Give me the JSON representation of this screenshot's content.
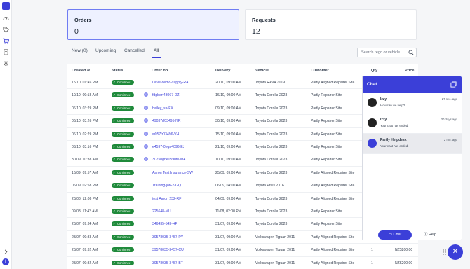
{
  "sidebar": {
    "icons": [
      "logo-icon",
      "dashboard-icon",
      "tag-icon",
      "cart-icon",
      "document-icon",
      "settings-icon"
    ],
    "expand_icon": "chevron-right-icon",
    "user_initial": "I"
  },
  "cards": {
    "orders": {
      "title": "Orders",
      "value": "0"
    },
    "requests": {
      "title": "Requests",
      "value": "12"
    }
  },
  "tabs": [
    {
      "label": "New (0)"
    },
    {
      "label": "Upcoming"
    },
    {
      "label": "Cancelled"
    },
    {
      "label": "All"
    }
  ],
  "search": {
    "placeholder": "Search rego or vehicle"
  },
  "table": {
    "headers": [
      "Created at",
      "Status",
      "Order no.",
      "Delivery",
      "Vehicle",
      "Customer",
      "Qty.",
      "Price"
    ],
    "rows": [
      {
        "created": "15/10, 01:45 PM",
        "status": "Confirmed",
        "order": "Dave-demo-supply-RA",
        "delivery": "20/10, 09:00 AM",
        "vehicle": "Toyota RAV4 2019",
        "customer": "Partly Aligned Repairer Site",
        "qty": "",
        "price": ""
      },
      {
        "created": "10/10, 09:18 AM",
        "status": "Confirmed",
        "order": "fdgbert43067-DZ",
        "delivery": "16/10, 09:00 AM",
        "vehicle": "Toyota Corolla 2023",
        "customer": "Partly Repairer Site",
        "qty": "",
        "price": ""
      },
      {
        "created": "06/10, 03:29 PM",
        "status": "Confirmed",
        "order": "bailey_sa-FX",
        "delivery": "09/10, 09:00 AM",
        "vehicle": "Toyota Corolla 2023",
        "customer": "Partly Repairer Site",
        "qty": "",
        "price": ""
      },
      {
        "created": "06/10, 03:26 PM",
        "status": "Confirmed",
        "order": "49037rf03495-NR",
        "delivery": "30/10, 09:00 AM",
        "vehicle": "Toyota Corolla 2023",
        "customer": "Partly Repairer Site",
        "qty": "",
        "price": ""
      },
      {
        "created": "06/10, 02:29 PM",
        "status": "Confirmed",
        "order": "w057fr03496-VH",
        "delivery": "15/10, 09:00 AM",
        "vehicle": "Toyota Corolla 2023",
        "customer": "Partly Repairer Site",
        "qty": "",
        "price": ""
      },
      {
        "created": "03/10, 03:16 PM",
        "status": "Confirmed",
        "order": "e4597-0egn4096-EJ",
        "delivery": "21/10, 09:00 AM",
        "vehicle": "Toyota Corolla 2023",
        "customer": "Partly Repairer Site",
        "qty": "",
        "price": ""
      },
      {
        "created": "30/09, 10:38 AM",
        "status": "Confirmed",
        "order": "30750gne059ute-MA",
        "delivery": "10/10, 09:00 AM",
        "vehicle": "Toyota Corolla 2023",
        "customer": "Partly Repairer Site",
        "qty": "",
        "price": ""
      },
      {
        "created": "16/09, 09:57 AM",
        "status": "Confirmed",
        "order": "Aaron Test Insurance-SW",
        "delivery": "25/09, 09:00 AM",
        "vehicle": "Toyota Corolla 2023",
        "customer": "Partly Aligned Repairer Site",
        "qty": "",
        "price": ""
      },
      {
        "created": "06/09, 02:58 PM",
        "status": "Confirmed",
        "order": "Training-job-2-GQ",
        "delivery": "06/09, 04:00 AM",
        "vehicle": "Toyota Prius 2016",
        "customer": "Partly Aligned Repairer Site",
        "qty": "",
        "price": ""
      },
      {
        "created": "28/08, 12:08 PM",
        "status": "Confirmed",
        "order": "test Aaron 232-RF",
        "delivery": "04/09, 09:00 AM",
        "vehicle": "Toyota Corolla 2023",
        "customer": "Partly Aligned Repairer Site",
        "qty": "",
        "price": ""
      },
      {
        "created": "09/08, 11:42 AM",
        "status": "Confirmed",
        "order": "225648-MU",
        "delivery": "11/08, 02:00 PM",
        "vehicle": "Toyota Corolla 2023",
        "customer": "Partly Repairer Site",
        "qty": "",
        "price": ""
      },
      {
        "created": "28/07, 09:34 AM",
        "status": "Confirmed",
        "order": "346435-543-HP",
        "delivery": "31/07, 09:00 AM",
        "vehicle": "Toyota Corolla 2023",
        "customer": "Partly Repairer Site",
        "qty": "",
        "price": ""
      },
      {
        "created": "28/07, 09:33 AM",
        "status": "Confirmed",
        "order": "39578035-3457-PY",
        "delivery": "31/07, 09:00 AM",
        "vehicle": "Volkswagen Tiguan 2011",
        "customer": "Partly Aligned Repairer Site",
        "qty": "",
        "price": ""
      },
      {
        "created": "28/07, 09:32 AM",
        "status": "Confirmed",
        "order": "39578035-3457-CU",
        "delivery": "31/07, 09:00 AM",
        "vehicle": "Volkswagen Tiguan 2011",
        "customer": "Partly Aligned Repairer Site",
        "qty": "1",
        "price": "NZ$200.00"
      },
      {
        "created": "28/07, 09:32 AM",
        "status": "Confirmed",
        "order": "39578035-3457-BT",
        "delivery": "31/07, 09:00 AM",
        "vehicle": "Volkswagen Tiguan 2011",
        "customer": "Partly Aligned Repairer Site",
        "qty": "1",
        "price": "NZ$200.00"
      }
    ]
  },
  "chat": {
    "title": "Chat",
    "conversations": [
      {
        "name": "Izzy",
        "message": "How can we help?",
        "time": "27 sec. ago",
        "selected": false
      },
      {
        "name": "Izzy",
        "message": "Your chat has ended.",
        "time": "30 days ago",
        "selected": false
      },
      {
        "name": "Partly Helpdesk",
        "message": "Your chat has ended.",
        "time": "2 mo. ago",
        "selected": true
      }
    ],
    "chat_button": "Chat",
    "help_button": "Help"
  },
  "colors": {
    "accent": "#3b3fd8",
    "confirmed": "#1f8a3b",
    "orders_card_bg": "#eef1ff"
  }
}
